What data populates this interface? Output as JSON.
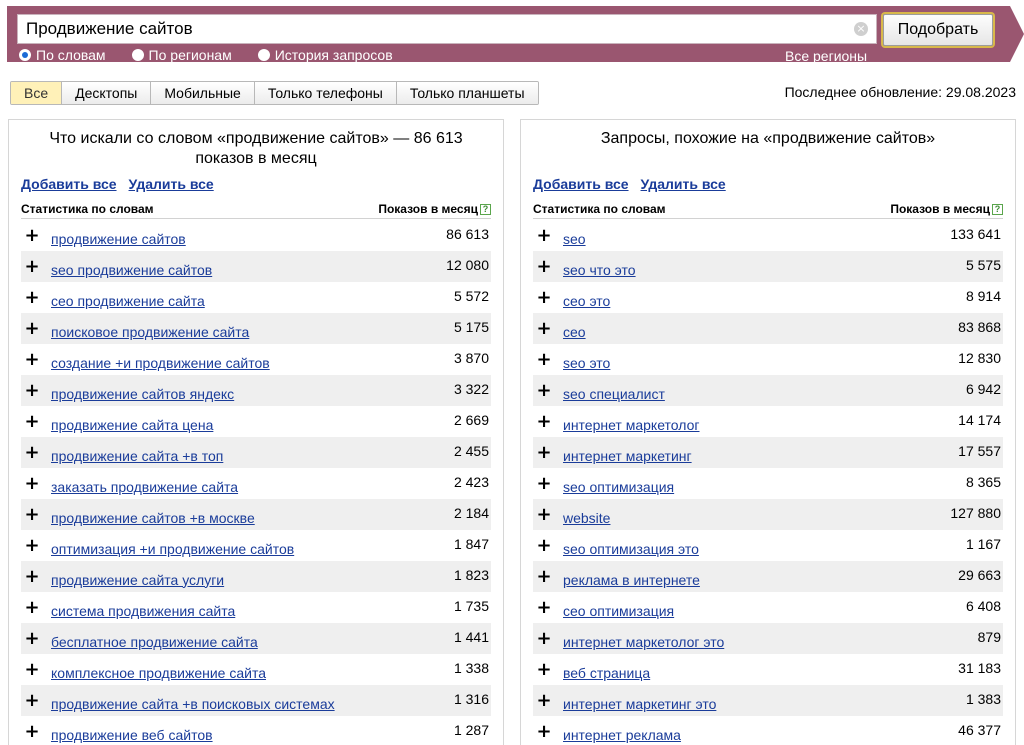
{
  "search": {
    "value": "Продвижение сайтов",
    "submit_label": "Подобрать",
    "clear_icon": "×"
  },
  "modes": [
    {
      "label": "По словам",
      "checked": true
    },
    {
      "label": "По регионам",
      "checked": false
    },
    {
      "label": "История запросов",
      "checked": false
    }
  ],
  "regions_link": "Все регионы",
  "tabs": [
    {
      "label": "Все",
      "active": true
    },
    {
      "label": "Десктопы",
      "active": false
    },
    {
      "label": "Мобильные",
      "active": false
    },
    {
      "label": "Только телефоны",
      "active": false
    },
    {
      "label": "Только планшеты",
      "active": false
    }
  ],
  "last_update": "Последнее обновление: 29.08.2023",
  "left_panel": {
    "title": "Что искали со словом «продвижение сайтов» — 86 613 показов в месяц",
    "add_all": "Добавить все",
    "remove_all": "Удалить все",
    "col_words": "Статистика по словам",
    "col_count": "Показов в месяц",
    "rows": [
      {
        "phrase": "продвижение сайтов",
        "count": "86 613"
      },
      {
        "phrase": "seo продвижение сайтов",
        "count": "12 080"
      },
      {
        "phrase": "сео продвижение сайта",
        "count": "5 572"
      },
      {
        "phrase": "поисковое продвижение сайта",
        "count": "5 175"
      },
      {
        "phrase": "создание +и продвижение сайтов",
        "count": "3 870"
      },
      {
        "phrase": "продвижение сайтов яндекс",
        "count": "3 322"
      },
      {
        "phrase": "продвижение сайта цена",
        "count": "2 669"
      },
      {
        "phrase": "продвижение сайта +в топ",
        "count": "2 455"
      },
      {
        "phrase": "заказать продвижение сайта",
        "count": "2 423"
      },
      {
        "phrase": "продвижение сайтов +в москве",
        "count": "2 184"
      },
      {
        "phrase": "оптимизация +и продвижение сайтов",
        "count": "1 847"
      },
      {
        "phrase": "продвижение сайта услуги",
        "count": "1 823"
      },
      {
        "phrase": "система продвижения сайта",
        "count": "1 735"
      },
      {
        "phrase": "бесплатное продвижение сайта",
        "count": "1 441"
      },
      {
        "phrase": "комплексное продвижение сайта",
        "count": "1 338"
      },
      {
        "phrase": "продвижение сайта +в поисковых системах",
        "count": "1 316"
      },
      {
        "phrase": "продвижение веб сайтов",
        "count": "1 287"
      }
    ]
  },
  "right_panel": {
    "title": "Запросы, похожие на «продвижение сайтов»",
    "add_all": "Добавить все",
    "remove_all": "Удалить все",
    "col_words": "Статистика по словам",
    "col_count": "Показов в месяц",
    "rows": [
      {
        "phrase": "seo",
        "count": "133 641"
      },
      {
        "phrase": "seo что это",
        "count": "5 575"
      },
      {
        "phrase": "сео это",
        "count": "8 914"
      },
      {
        "phrase": "сео",
        "count": "83 868"
      },
      {
        "phrase": "seo это",
        "count": "12 830"
      },
      {
        "phrase": "seo специалист",
        "count": "6 942"
      },
      {
        "phrase": "интернет маркетолог",
        "count": "14 174"
      },
      {
        "phrase": "интернет маркетинг",
        "count": "17 557"
      },
      {
        "phrase": "seo оптимизация",
        "count": "8 365"
      },
      {
        "phrase": "website",
        "count": "127 880"
      },
      {
        "phrase": "seo оптимизация это",
        "count": "1 167"
      },
      {
        "phrase": "реклама в интернете",
        "count": "29 663"
      },
      {
        "phrase": "сео оптимизация",
        "count": "6 408"
      },
      {
        "phrase": "интернет маркетолог это",
        "count": "879"
      },
      {
        "phrase": "веб страница",
        "count": "31 183"
      },
      {
        "phrase": "интернет маркетинг это",
        "count": "1 383"
      },
      {
        "phrase": "интернет реклама",
        "count": "46 377"
      }
    ]
  },
  "colors": {
    "header": "#9a5670",
    "link": "#1a3c9a",
    "active_tab": "#fff1b8",
    "row_stripe": "#efefef"
  }
}
